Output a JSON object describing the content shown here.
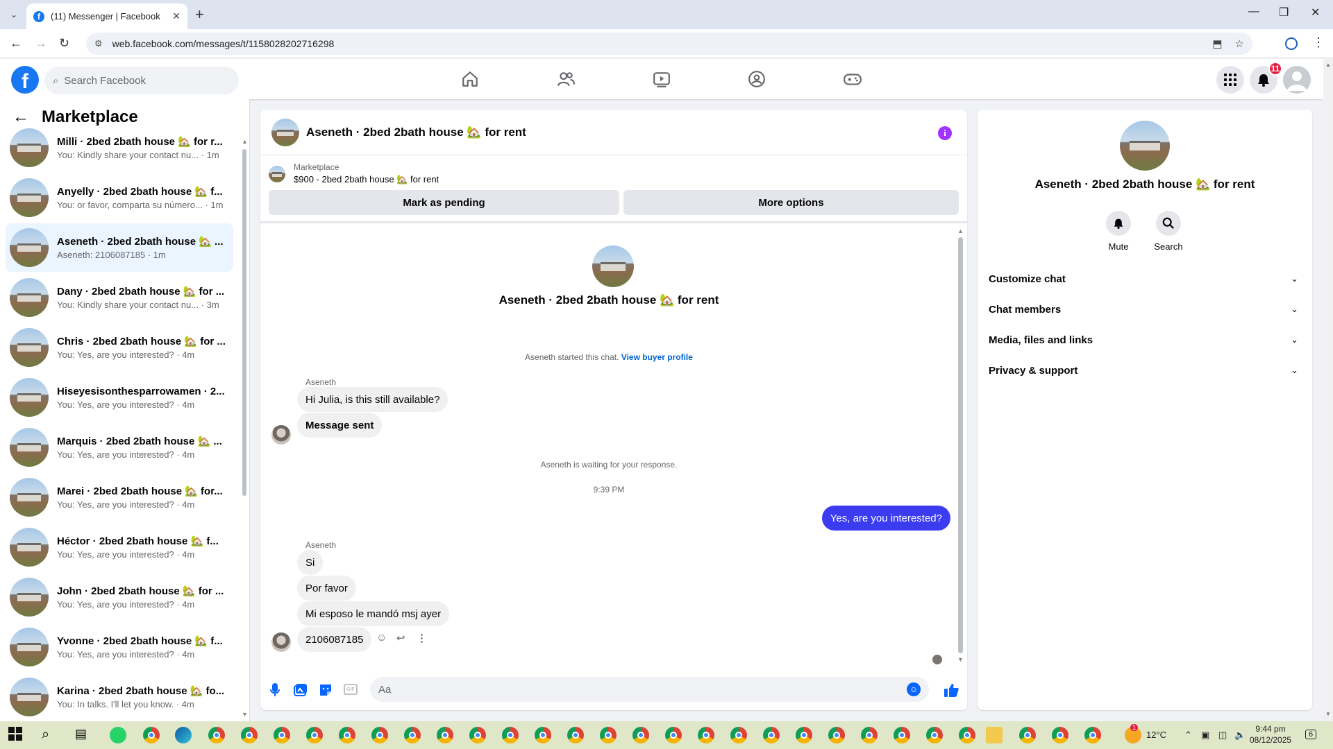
{
  "browser": {
    "tab_title": "(11) Messenger | Facebook",
    "url": "web.facebook.com/messages/t/1158028202716298"
  },
  "fb": {
    "search_placeholder": "Search Facebook",
    "notification_count": "11",
    "brand_color": "#1877f2"
  },
  "sidebar": {
    "title": "Marketplace",
    "conversations": [
      {
        "name": "Milli · 2bed 2bath house 🏡 for r...",
        "preview": "You: Kindly share your contact nu...",
        "time": "1m"
      },
      {
        "name": "Anyelly · 2bed 2bath house 🏡 f...",
        "preview": "You: or favor, comparta su número...",
        "time": "1m"
      },
      {
        "name": "Aseneth · 2bed 2bath house 🏡 ...",
        "preview": "Aseneth: 2106087185 · 1m",
        "time": ""
      },
      {
        "name": "Dany · 2bed 2bath house 🏡 for ...",
        "preview": "You: Kindly share your contact nu...",
        "time": "3m"
      },
      {
        "name": "Chris · 2bed 2bath house 🏡 for ...",
        "preview": "You: Yes, are you interested? · 4m",
        "time": ""
      },
      {
        "name": "Hiseyesisonthesparrowamen · 2...",
        "preview": "You: Yes, are you interested? · 4m",
        "time": ""
      },
      {
        "name": "Marquis · 2bed 2bath house 🏡 ...",
        "preview": "You: Yes, are you interested? · 4m",
        "time": ""
      },
      {
        "name": "Marei · 2bed 2bath house 🏡 for...",
        "preview": "You: Yes, are you interested? · 4m",
        "time": ""
      },
      {
        "name": "Héctor · 2bed 2bath house 🏡 f...",
        "preview": "You: Yes, are you interested? · 4m",
        "time": ""
      },
      {
        "name": "John · 2bed 2bath house 🏡 for ...",
        "preview": "You: Yes, are you interested? · 4m",
        "time": ""
      },
      {
        "name": "Yvonne · 2bed 2bath house 🏡 f...",
        "preview": "You: Yes, are you interested? · 4m",
        "time": ""
      },
      {
        "name": "Karina · 2bed 2bath house 🏡 fo...",
        "preview": "You: In talks. I'll let you know. · 4m",
        "time": ""
      }
    ]
  },
  "chat": {
    "title": "Aseneth · 2bed 2bath house 🏡 for rent",
    "marketplace_label": "Marketplace",
    "listing": "$900 - 2bed 2bath house 🏡 for rent",
    "mark_pending": "Mark as pending",
    "more_options": "More options",
    "hero_name": "Aseneth · 2bed 2bath house 🏡 for rent",
    "started_text": "Aseneth started this chat.",
    "view_profile": "View buyer profile",
    "sender": "Aseneth",
    "msg1": "Hi Julia, is this still available?",
    "msg2": "Message sent",
    "waiting": "Aseneth is waiting for your response.",
    "timestamp": "9:39 PM",
    "outgoing": "Yes, are you interested?",
    "msg3": "Si",
    "msg4": "Por favor",
    "msg5": "Mi esposo le mandó msj ayer",
    "msg6": "2106087185",
    "composer_placeholder": "Aa",
    "outgoing_color": "#3b3bf0"
  },
  "info": {
    "name": "Aseneth · 2bed 2bath house 🏡 for rent",
    "mute": "Mute",
    "search": "Search",
    "sections": [
      "Customize chat",
      "Chat members",
      "Media, files and links",
      "Privacy & support"
    ]
  },
  "taskbar": {
    "weather": "12°C",
    "time": "9:44 pm",
    "date": "08/12/2025",
    "notif_count": "6",
    "weather_badge": "1"
  }
}
